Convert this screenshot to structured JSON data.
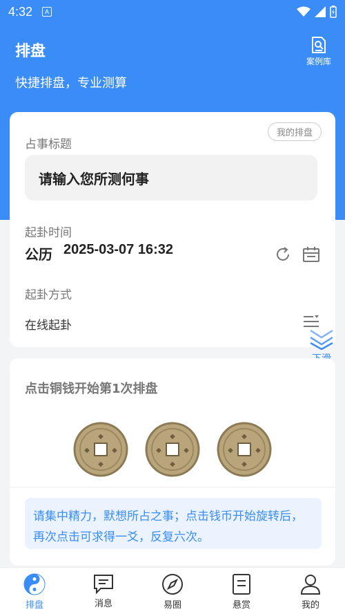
{
  "status": {
    "time": "4:32",
    "notif_letter": "A"
  },
  "header": {
    "title": "排盘",
    "subtitle": "快捷排盘，专业测算",
    "case_label": "案例库"
  },
  "form": {
    "my_pan_label": "我的排盘",
    "topic_label": "占事标题",
    "topic_placeholder": "请输入您所测何事",
    "time_label": "起卦时间",
    "calendar_type": "公历",
    "datetime": "2025-03-07 16:32",
    "method_label": "起卦方式",
    "method_value": "在线起卦"
  },
  "scroll_hint": "下滑",
  "coin_section": {
    "title": "点击铜钱开始第1次排盘",
    "hint": "请集中精力，默想所占之事；点击钱币开始旋转后，再次点击可求得一爻，反复六次。"
  },
  "tabs": [
    {
      "label": "排盘",
      "icon": "taiji-icon",
      "active": true
    },
    {
      "label": "消息",
      "icon": "message-icon",
      "active": false
    },
    {
      "label": "易圈",
      "icon": "compass-icon",
      "active": false
    },
    {
      "label": "悬赏",
      "icon": "document-icon",
      "active": false
    },
    {
      "label": "我的",
      "icon": "user-icon",
      "active": false
    }
  ],
  "colors": {
    "primary": "#3a8cf6",
    "coin": "#b8a57c"
  }
}
